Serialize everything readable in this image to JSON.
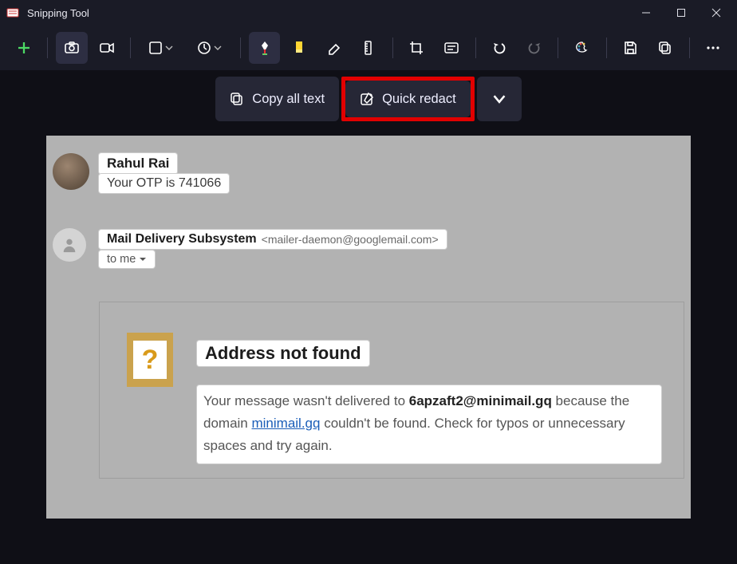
{
  "window": {
    "title": "Snipping Tool"
  },
  "actions": {
    "copy_all": "Copy all text",
    "quick_redact": "Quick redact"
  },
  "email": {
    "sender1_name": "Rahul Rai",
    "sender1_subject": "Your OTP is 741066",
    "sender2_name": "Mail Delivery Subsystem",
    "sender2_email": "<mailer-daemon@googlemail.com>",
    "to_line": "to me",
    "error": {
      "heading": "Address not found",
      "body_pre": "Your message wasn't delivered to ",
      "body_email": "6apzaft2@minimail.gq",
      "body_mid": " because the domain ",
      "body_link": "minimail.gq",
      "body_post": " couldn't be found. Check for typos or unnecessary spaces and try again."
    }
  }
}
